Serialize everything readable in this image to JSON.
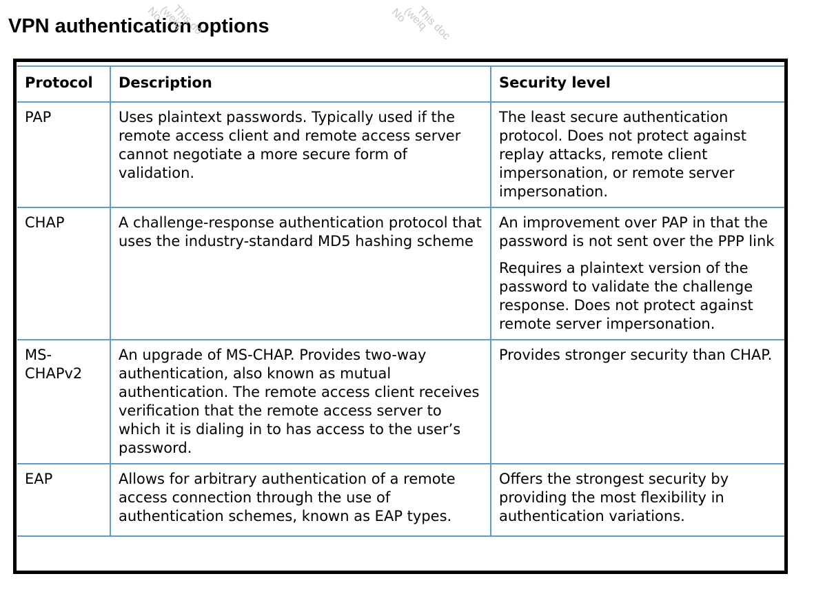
{
  "title": "VPN authentication options",
  "watermarks": [
    [
      "This do",
      "(weiq",
      "No"
    ],
    [
      "This doc",
      "(weiq",
      "No"
    ]
  ],
  "table": {
    "headers": [
      "Protocol",
      "Description",
      "Security level"
    ],
    "rows": [
      {
        "protocol": "PAP",
        "description": "Uses plaintext passwords. Typically used if the remote access client and remote access server cannot negotiate a more secure form of validation.",
        "security": [
          "The least secure authentication protocol. Does not protect against replay attacks, remote client impersonation, or remote server impersonation."
        ]
      },
      {
        "protocol": "CHAP",
        "description": "A challenge-response authentication protocol that uses the industry-standard MD5 hashing scheme",
        "security": [
          "An improvement over PAP in that the password is not sent over the PPP link",
          "Requires a plaintext version of the password to validate the challenge response. Does not protect against remote server impersonation."
        ]
      },
      {
        "protocol": "MS-CHAPv2",
        "description": "An upgrade of MS-CHAP. Provides two-way authentication, also known as mutual authentication. The remote access client receives verification that the remote access server to which it is dialing in to has access to the user’s password.",
        "security": [
          "Provides stronger security than CHAP."
        ]
      },
      {
        "protocol": "EAP",
        "description": "Allows for arbitrary authentication of a remote access connection through the use of authentication schemes, known as EAP types.",
        "security": [
          "Offers the strongest security by providing the most flexibility in authentication variations."
        ]
      }
    ]
  },
  "colors": {
    "grid": "#5b9bd5",
    "frame": "#000000",
    "watermark": "#c9c9c9"
  }
}
